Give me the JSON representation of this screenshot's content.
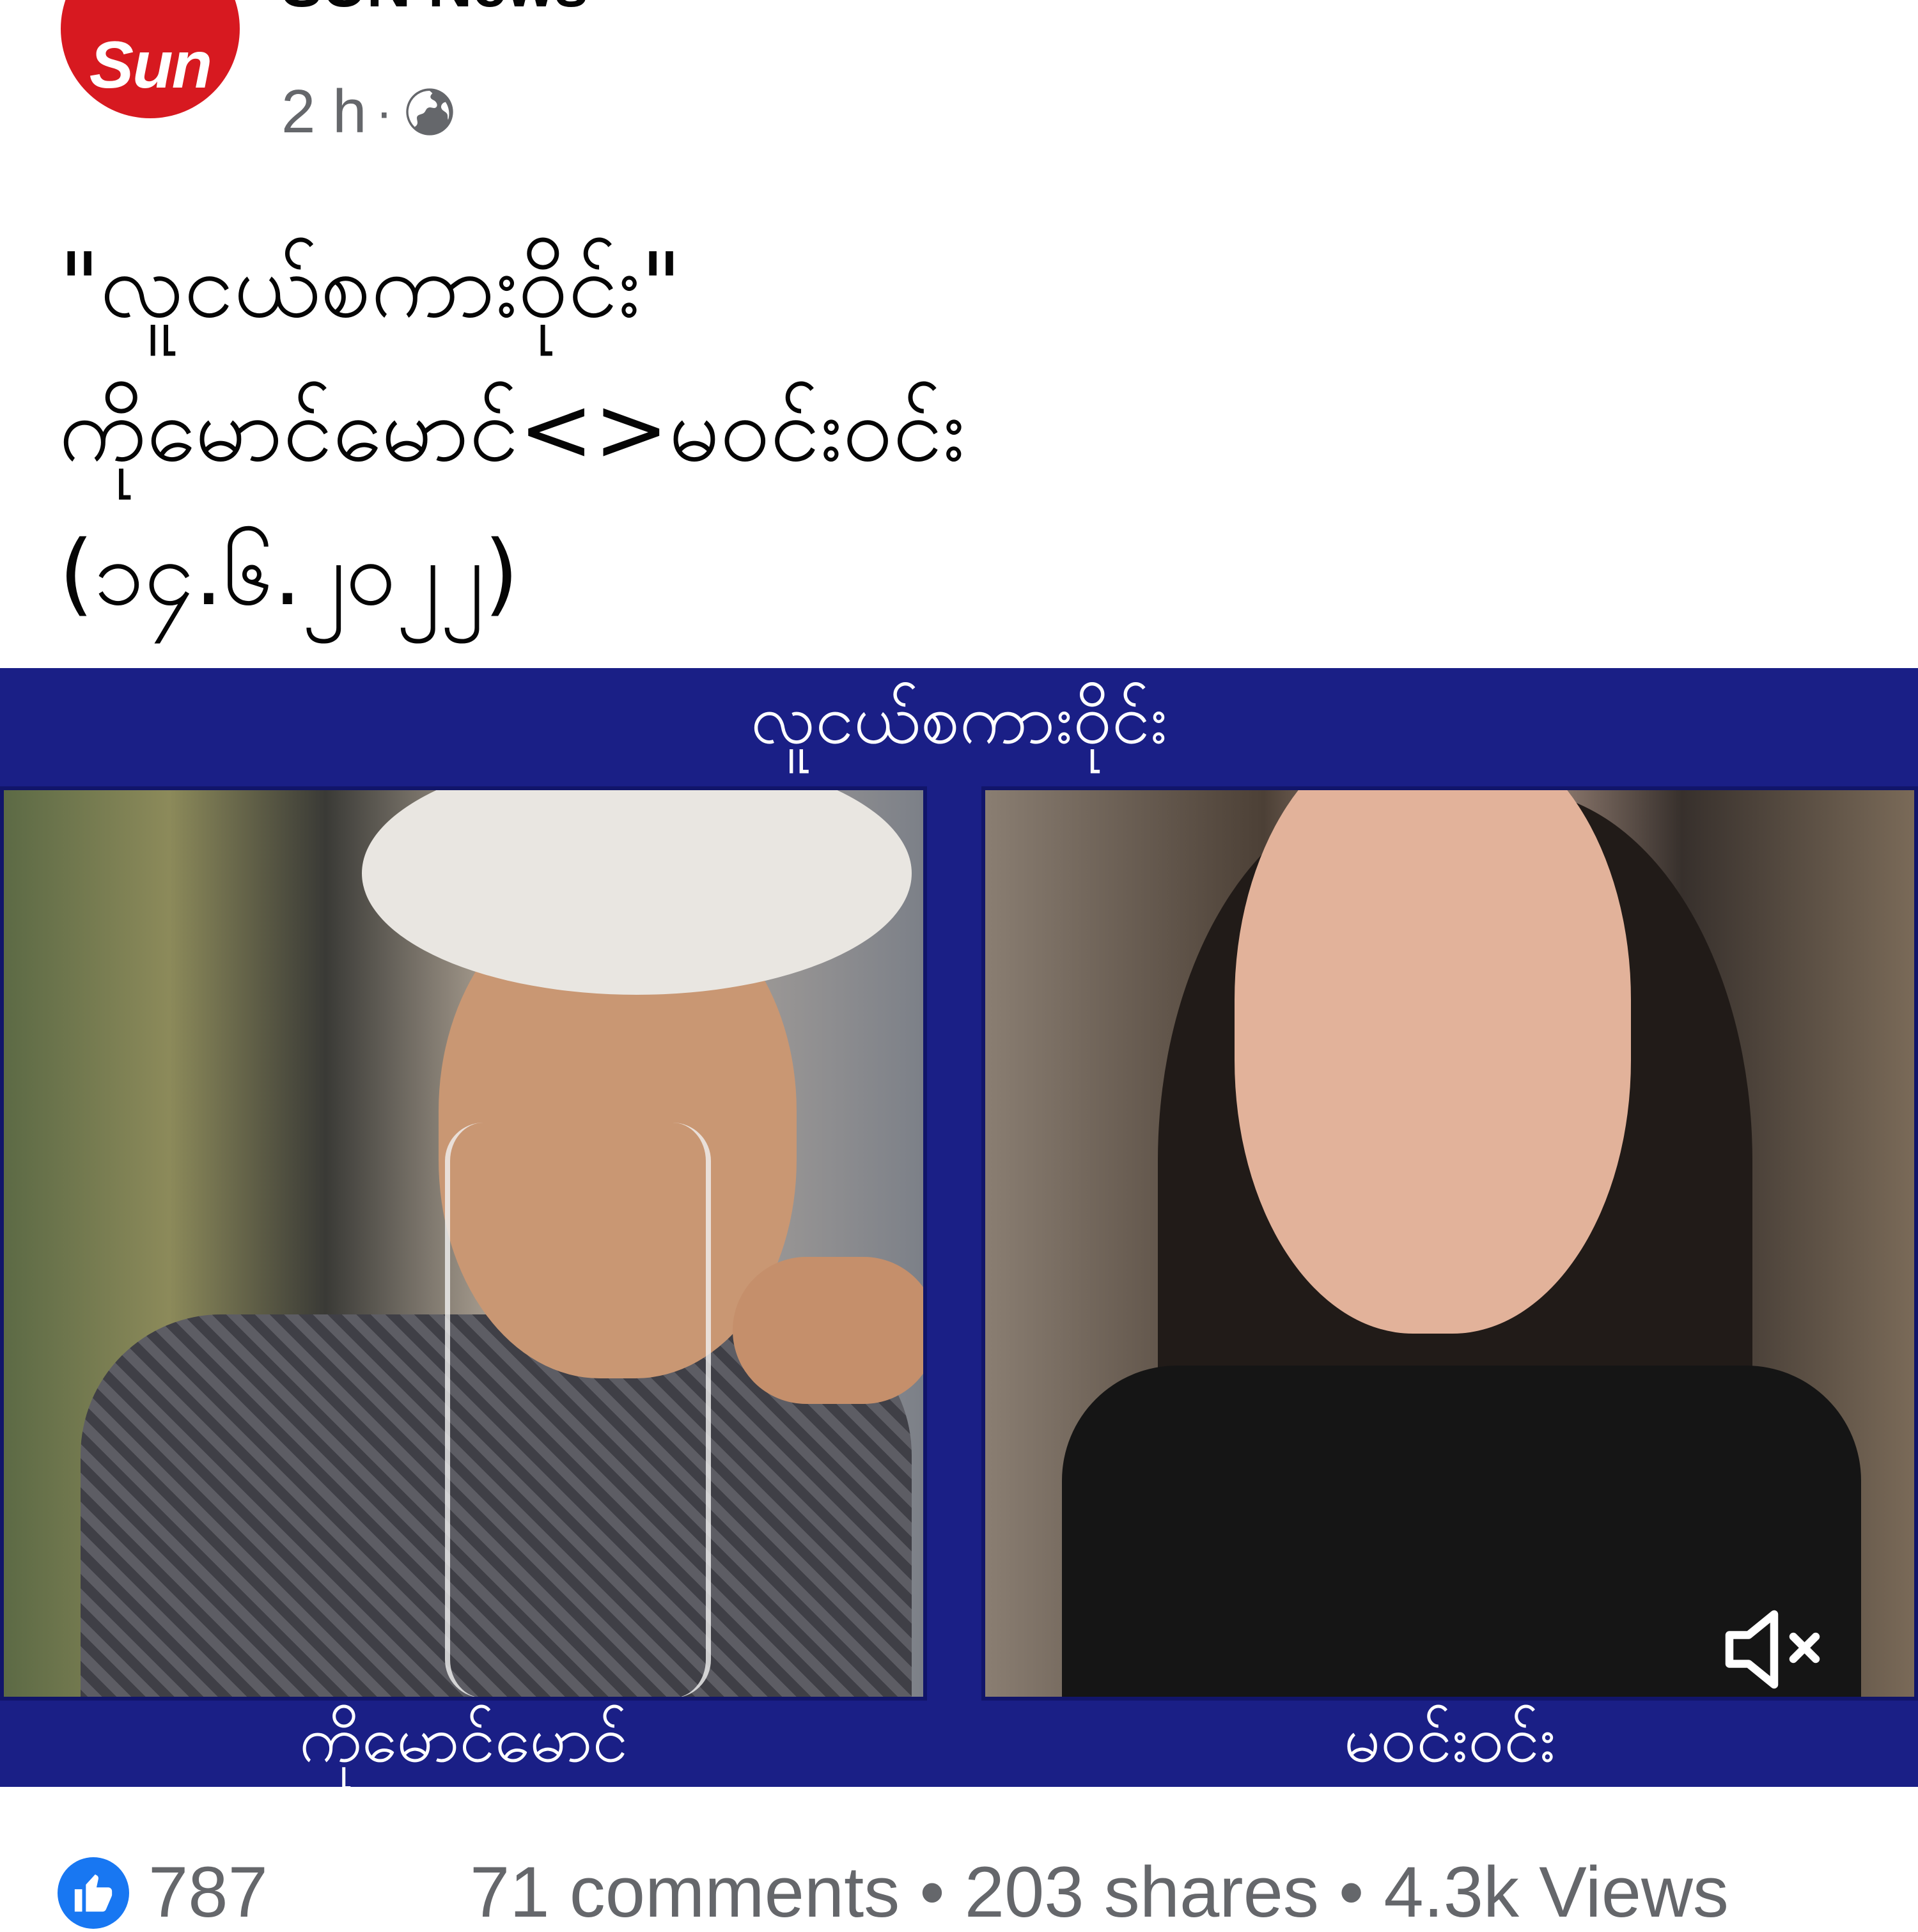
{
  "post": {
    "page_name": "SUN News",
    "avatar_text": "Sun",
    "time": "2 h",
    "separator": "·",
    "icon": "globe-icon",
    "text_lines": [
      "\"လူငယ်စကားဝိုင်း\"",
      "ကိုမောင်မောင်<>မဝင်းဝင်း",
      "(၁၄.၆.၂၀၂၂)"
    ]
  },
  "video": {
    "title": "လူငယ်စကားဝိုင်း",
    "left_speaker": "ကိုမောင်မောင်",
    "right_speaker": "မဝင်းဝင်း",
    "muted_icon": "mute-icon",
    "background_color": "#1a1f86"
  },
  "engagement": {
    "like_icon": "thumbs-up-icon",
    "reactions": "787",
    "stats": "71 comments • 203 shares • 4.3k Views"
  }
}
